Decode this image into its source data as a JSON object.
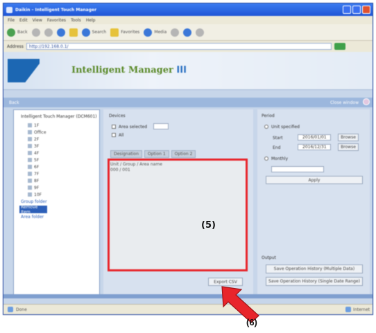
{
  "window": {
    "title": "Daikin – Intelligent Touch Manager"
  },
  "menu": [
    "File",
    "Edit",
    "View",
    "Favorites",
    "Tools",
    "Help"
  ],
  "toolbar": {
    "back": "Back",
    "search": "Search",
    "favorites": "Favorites",
    "media": "Media"
  },
  "address": {
    "label": "Address",
    "value": "http://192.168.0.1/"
  },
  "banner": {
    "product_name": "Intelligent Manager",
    "product_suffix": "III"
  },
  "subbar": {
    "left": "Back",
    "right": "Close window"
  },
  "tree": {
    "root": "Intelligent Touch Manager (DCM601)",
    "items": [
      "1F",
      "Office",
      "2F",
      "3F",
      "4F",
      "5F",
      "6F",
      "7F",
      "8F",
      "9F",
      "10F"
    ],
    "selected": "Remove Item",
    "others": [
      "Group folder",
      "Area folder"
    ]
  },
  "main": {
    "section_title": "Devices",
    "cb1": "Area selected",
    "cb2": "All",
    "tabs": [
      "Designation",
      "Option 1",
      "Option 2"
    ],
    "list_lines": [
      "Unit / Group / Area name",
      "000 / 001"
    ],
    "export_button": "Export CSV"
  },
  "right": {
    "section_title": "Period",
    "radio1": "Unit specified",
    "start_label": "Start",
    "start_value": "2016/01/01",
    "end_label": "End",
    "end_value": "2016/12/31",
    "browse": "Browse",
    "radio2": "Monthly",
    "apply_button": "Apply",
    "output_title": "Output",
    "button1": "Save Operation History (Multiple Data)",
    "button2": "Save Operation History (Single Date Range)"
  },
  "status": {
    "left": "Done",
    "right": "Internet"
  },
  "annotations": {
    "box": "(5)",
    "arrow": "(6)"
  },
  "colors": {
    "highlight": "#e8252b",
    "arrow": "#e8252b"
  }
}
